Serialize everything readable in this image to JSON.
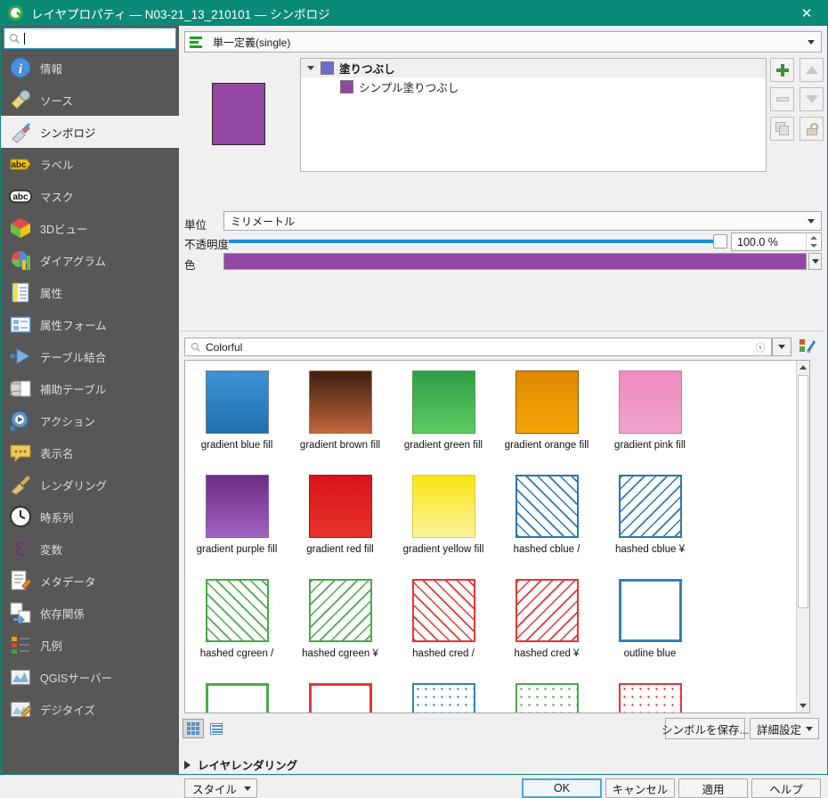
{
  "window": {
    "title": "レイヤプロパティ — N03-21_13_210101 — シンボロジ",
    "close_label": "✕",
    "accent_color": "#0b8a78"
  },
  "sidebar": {
    "search_placeholder": "",
    "search_value": "",
    "items": [
      {
        "label": "情報",
        "icon": "info-icon",
        "selected": false
      },
      {
        "label": "ソース",
        "icon": "source-icon",
        "selected": false
      },
      {
        "label": "シンボロジ",
        "icon": "symbology-icon",
        "selected": true
      },
      {
        "label": "ラベル",
        "icon": "label-icon",
        "selected": false
      },
      {
        "label": "マスク",
        "icon": "mask-icon",
        "selected": false
      },
      {
        "label": "3Dビュー",
        "icon": "3dview-icon",
        "selected": false
      },
      {
        "label": "ダイアグラム",
        "icon": "diagram-icon",
        "selected": false
      },
      {
        "label": "属性",
        "icon": "attributes-icon",
        "selected": false
      },
      {
        "label": "属性フォーム",
        "icon": "attribute-form-icon",
        "selected": false
      },
      {
        "label": "テーブル結合",
        "icon": "joins-icon",
        "selected": false
      },
      {
        "label": "補助テーブル",
        "icon": "auxiliary-storage-icon",
        "selected": false
      },
      {
        "label": "アクション",
        "icon": "actions-icon",
        "selected": false
      },
      {
        "label": "表示名",
        "icon": "display-name-icon",
        "selected": false
      },
      {
        "label": "レンダリング",
        "icon": "rendering-icon",
        "selected": false
      },
      {
        "label": "時系列",
        "icon": "temporal-icon",
        "selected": false
      },
      {
        "label": "変数",
        "icon": "variables-icon",
        "selected": false
      },
      {
        "label": "メタデータ",
        "icon": "metadata-icon",
        "selected": false
      },
      {
        "label": "依存関係",
        "icon": "dependencies-icon",
        "selected": false
      },
      {
        "label": "凡例",
        "icon": "legend-icon",
        "selected": false
      },
      {
        "label": "QGISサーバー",
        "icon": "qgis-server-icon",
        "selected": false
      },
      {
        "label": "デジタイズ",
        "icon": "digitizing-icon",
        "selected": false
      }
    ]
  },
  "symbology": {
    "renderer": "単一定義(single)",
    "preview_color": "#9248a3",
    "tree": [
      {
        "label": "塗りつぶし",
        "swatch": "#6d6dc8",
        "level": 0,
        "expanded": true
      },
      {
        "label": "シンプル塗りつぶし",
        "swatch": "#9248a3",
        "level": 1,
        "expanded": false
      }
    ],
    "layer_buttons": [
      {
        "name": "add-symbol-layer-button",
        "icon": "plus-icon"
      },
      {
        "name": "move-up-button",
        "icon": "triangle-up-icon"
      },
      {
        "name": "remove-symbol-layer-button",
        "icon": "minus-icon"
      },
      {
        "name": "move-down-button",
        "icon": "triangle-down-icon"
      },
      {
        "name": "duplicate-button",
        "icon": "duplicate-icon"
      },
      {
        "name": "lock-button",
        "icon": "lock-icon"
      }
    ],
    "unit_label": "単位",
    "unit_value": "ミリメートル",
    "opacity_label": "不透明度",
    "opacity_value": "100.0 %",
    "opacity_percent": 100,
    "color_label": "色",
    "color_value": "#9248a3"
  },
  "style_browser": {
    "search_value": "Colorful",
    "clear_icon": "clear-icon",
    "filter_icon": "chevron-down-icon",
    "style_manager_icon": "style-manager-icon",
    "view_grid_icon": "grid-view-icon",
    "view_list_icon": "list-view-icon",
    "symbols": [
      {
        "name": "gradient blue fill",
        "kind": "gradient",
        "from": "#3d93d4",
        "to": "#1f6fae",
        "border": "#6b7c88"
      },
      {
        "name": "gradient brown fill",
        "kind": "gradient",
        "from": "#3d1f10",
        "to": "#c1663a",
        "border": "#c1663a"
      },
      {
        "name": "gradient green fill",
        "kind": "gradient",
        "from": "#2f9e46",
        "to": "#5fcb63",
        "border": "#4a9e4a"
      },
      {
        "name": "gradient orange fill",
        "kind": "gradient",
        "from": "#e08800",
        "to": "#f6a406",
        "border": "#8a5800"
      },
      {
        "name": "gradient pink fill",
        "kind": "gradient",
        "from": "#ef8bbe",
        "to": "#f0a2cd",
        "border": "#c77ba8"
      },
      {
        "name": "gradient purple fill",
        "kind": "gradient",
        "from": "#6b2d82",
        "to": "#a062c0",
        "border": "#8a5aa0"
      },
      {
        "name": "gradient red fill",
        "kind": "gradient",
        "from": "#d91219",
        "to": "#e8342a",
        "border": "#b01016"
      },
      {
        "name": "gradient yellow fill",
        "kind": "gradient",
        "from": "#fae413",
        "to": "#fdf3a0",
        "border": "#e0cc3a"
      },
      {
        "name": "hashed cblue /",
        "kind": "hatch",
        "color": "#2a76ae",
        "angle": 45
      },
      {
        "name": "hashed cblue ¥",
        "kind": "hatch",
        "color": "#2a76ae",
        "angle": -45
      },
      {
        "name": "hashed cgreen /",
        "kind": "hatch",
        "color": "#4aa84a",
        "angle": 45
      },
      {
        "name": "hashed cgreen ¥",
        "kind": "hatch",
        "color": "#4aa84a",
        "angle": -45
      },
      {
        "name": "hashed cred /",
        "kind": "hatch",
        "color": "#e83434",
        "angle": 45
      },
      {
        "name": "hashed cred ¥",
        "kind": "hatch",
        "color": "#e83434",
        "angle": -45
      },
      {
        "name": "outline blue",
        "kind": "outline",
        "color": "#3580bd"
      },
      {
        "name": "",
        "kind": "outline",
        "color": "#4aa84a"
      },
      {
        "name": "",
        "kind": "outline",
        "color": "#e83434"
      },
      {
        "name": "",
        "kind": "dotted",
        "color": "#3580bd"
      },
      {
        "name": "",
        "kind": "dotted",
        "color": "#4aa84a"
      },
      {
        "name": "",
        "kind": "dotted",
        "color": "#e83434"
      }
    ],
    "save_symbol_label": "シンボルを保存...",
    "advanced_label": "詳細設定"
  },
  "footer": {
    "layer_rendering_label": "レイヤレンダリング",
    "style_label": "スタイル",
    "ok_label": "OK",
    "cancel_label": "キャンセル",
    "apply_label": "適用",
    "help_label": "ヘルプ"
  }
}
